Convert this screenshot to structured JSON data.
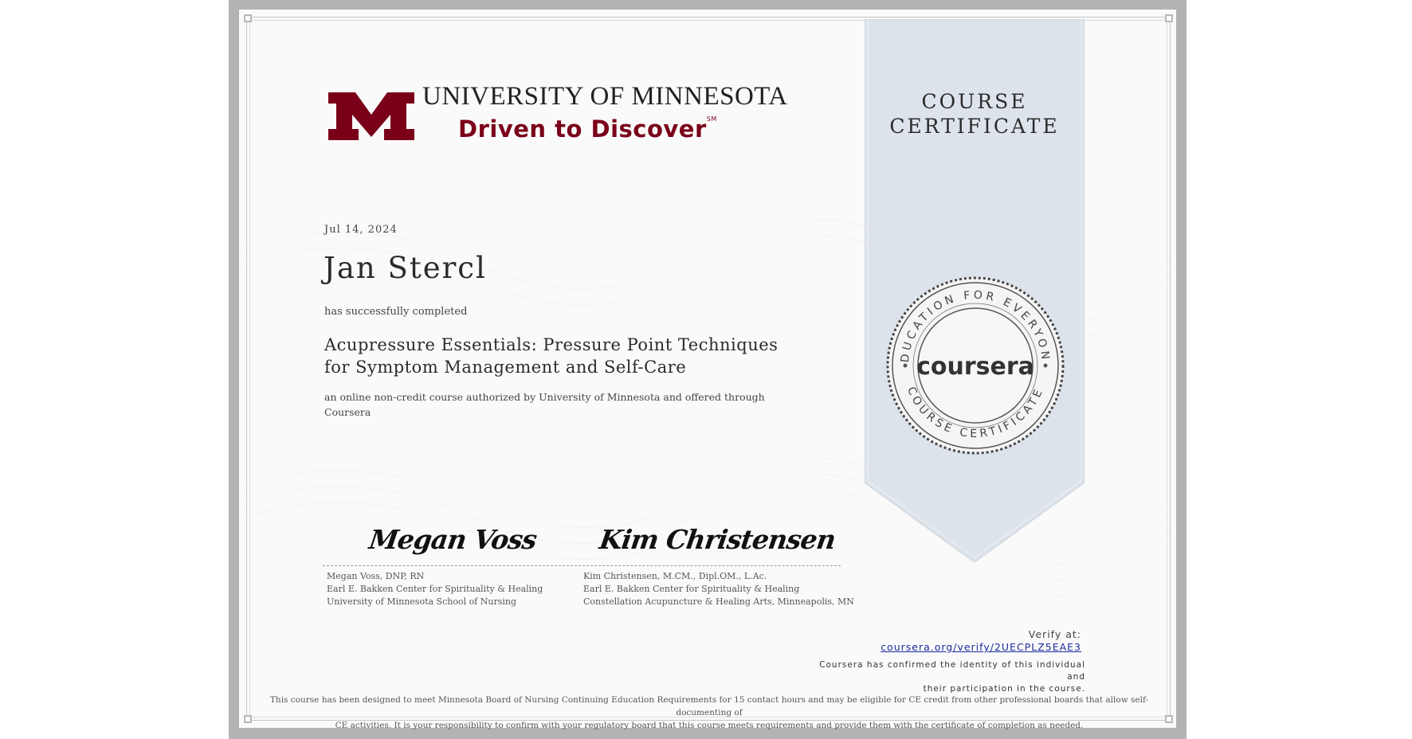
{
  "university": {
    "name": "UNIVERSITY OF MINNESOTA",
    "tagline": "Driven to Discover",
    "tagline_mark": "SM"
  },
  "certificate": {
    "type_line1": "COURSE",
    "type_line2": "CERTIFICATE",
    "date": "Jul 14, 2024",
    "recipient": "Jan Stercl",
    "completed_text": "has successfully completed",
    "course_title_line1": "Acupressure Essentials: Pressure Point Techniques",
    "course_title_line2": "for Symptom Management and Self-Care",
    "authorized_text": "an online non-credit course authorized by University of Minnesota and offered through Coursera"
  },
  "seal": {
    "brand": "coursera",
    "ring_top": "EDUCATION FOR EVERYONE",
    "ring_bottom": "COURSE CERTIFICATE"
  },
  "signers": [
    {
      "signature": "Megan Voss",
      "line1": "Megan Voss, DNP, RN",
      "line2": "Earl E. Bakken Center for Spirituality & Healing",
      "line3": "University of Minnesota School of Nursing"
    },
    {
      "signature": "Kim Christensen",
      "line1": "Kim Christensen, M.CM., Dipl.OM., L.Ac.",
      "line2": "Earl E. Bakken Center for Spirituality & Healing",
      "line3": "Constellation Acupuncture & Healing Arts, Minneapolis, MN"
    }
  ],
  "verification": {
    "label": "Verify at:",
    "url": "coursera.org/verify/2UECPLZ5EAE3",
    "confirm_line1": "Coursera has confirmed the identity of this individual and",
    "confirm_line2": "their participation in the course."
  },
  "footer": {
    "line1": "This course has been designed to meet Minnesota Board of Nursing Continuing Education Requirements for 15 contact hours and may be eligible for CE credit from other professional boards that allow self-documenting of",
    "line2": "CE activities. It is your responsibility to confirm with your regulatory board that this course meets requirements and provide them with the certificate of completion as needed."
  },
  "colors": {
    "maroon": "#7a0019",
    "ribbon": "#dde3ea",
    "link": "#1a2a9c"
  }
}
